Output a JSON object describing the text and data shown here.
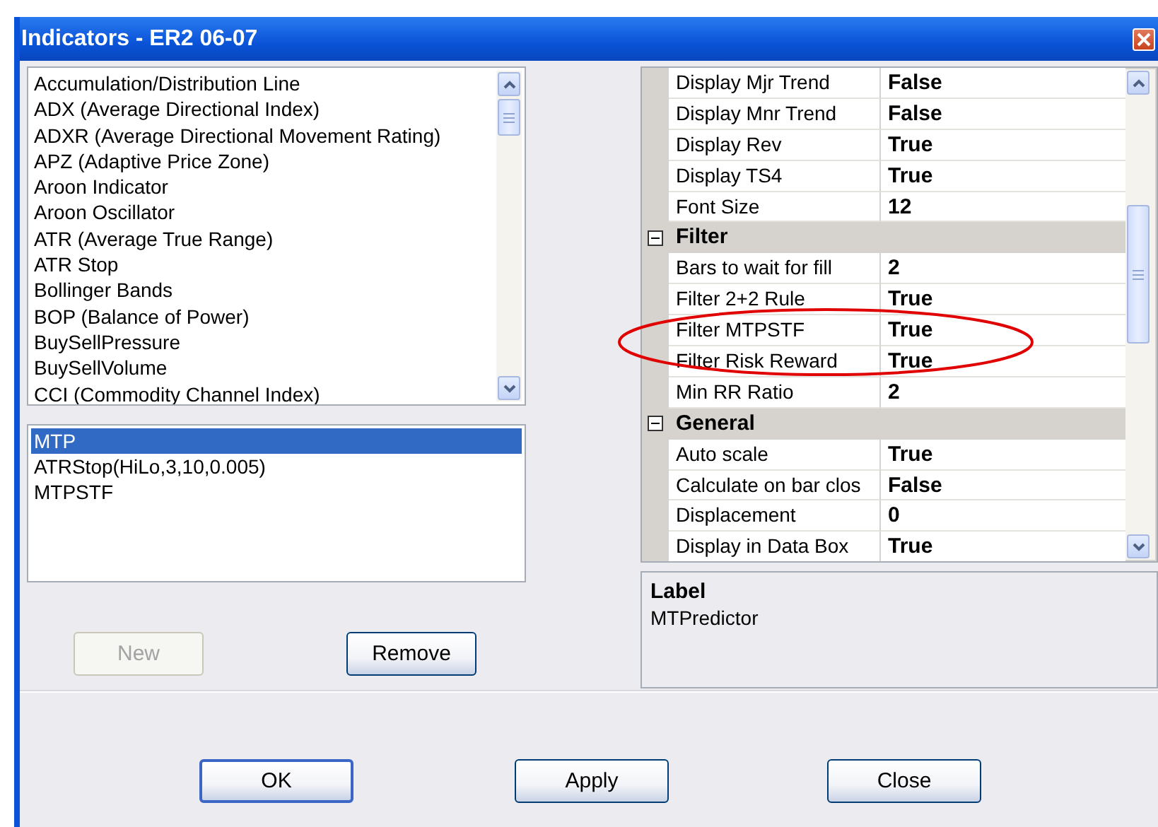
{
  "window": {
    "title": "Indicators - ER2 06-07"
  },
  "indicators": {
    "items": [
      "Accumulation/Distribution Line",
      "ADX (Average Directional Index)",
      "ADXR (Average Directional Movement Rating)",
      "APZ (Adaptive Price Zone)",
      "Aroon Indicator",
      "Aroon Oscillator",
      "ATR (Average True Range)",
      "ATR Stop",
      "Bollinger Bands",
      "BOP (Balance of Power)",
      "BuySellPressure",
      "BuySellVolume",
      "CCI (Commodity Channel Index)"
    ]
  },
  "applied": {
    "items": [
      {
        "label": "MTP",
        "selected": true
      },
      {
        "label": "ATRStop(HiLo,3,10,0.005)",
        "selected": false
      },
      {
        "label": "MTPSTF",
        "selected": false
      }
    ]
  },
  "list_buttons": [
    {
      "label": "New",
      "disabled": true
    },
    {
      "label": "Remove",
      "disabled": false
    }
  ],
  "properties": {
    "rows": [
      {
        "kind": "property",
        "name": "Display Mjr Trend",
        "value": "False"
      },
      {
        "kind": "property",
        "name": "Display Mnr Trend",
        "value": "False"
      },
      {
        "kind": "property",
        "name": "Display Rev",
        "value": "True"
      },
      {
        "kind": "property",
        "name": "Display TS4",
        "value": "True"
      },
      {
        "kind": "property",
        "name": "Font Size",
        "value": "12"
      },
      {
        "kind": "category",
        "name": "Filter",
        "expanded": true
      },
      {
        "kind": "property",
        "name": "Bars to wait for fill",
        "value": "2"
      },
      {
        "kind": "property",
        "name": "Filter 2+2 Rule",
        "value": "True"
      },
      {
        "kind": "property",
        "name": "Filter MTPSTF",
        "value": "True"
      },
      {
        "kind": "property",
        "name": "Filter Risk Reward",
        "value": "True"
      },
      {
        "kind": "property",
        "name": "Min RR Ratio",
        "value": "2"
      },
      {
        "kind": "category",
        "name": "General",
        "expanded": true
      },
      {
        "kind": "property",
        "name": "Auto scale",
        "value": "True"
      },
      {
        "kind": "property",
        "name": "Calculate on bar clos",
        "value": "False"
      },
      {
        "kind": "property",
        "name": "Displacement",
        "value": "0"
      },
      {
        "kind": "property",
        "name": "Display in Data Box",
        "value": "True"
      }
    ]
  },
  "description": {
    "title": "Label",
    "text": "MTPredictor"
  },
  "buttons": [
    {
      "label": "OK",
      "default": true
    },
    {
      "label": "Apply",
      "default": false
    },
    {
      "label": "Close",
      "default": false
    }
  ]
}
